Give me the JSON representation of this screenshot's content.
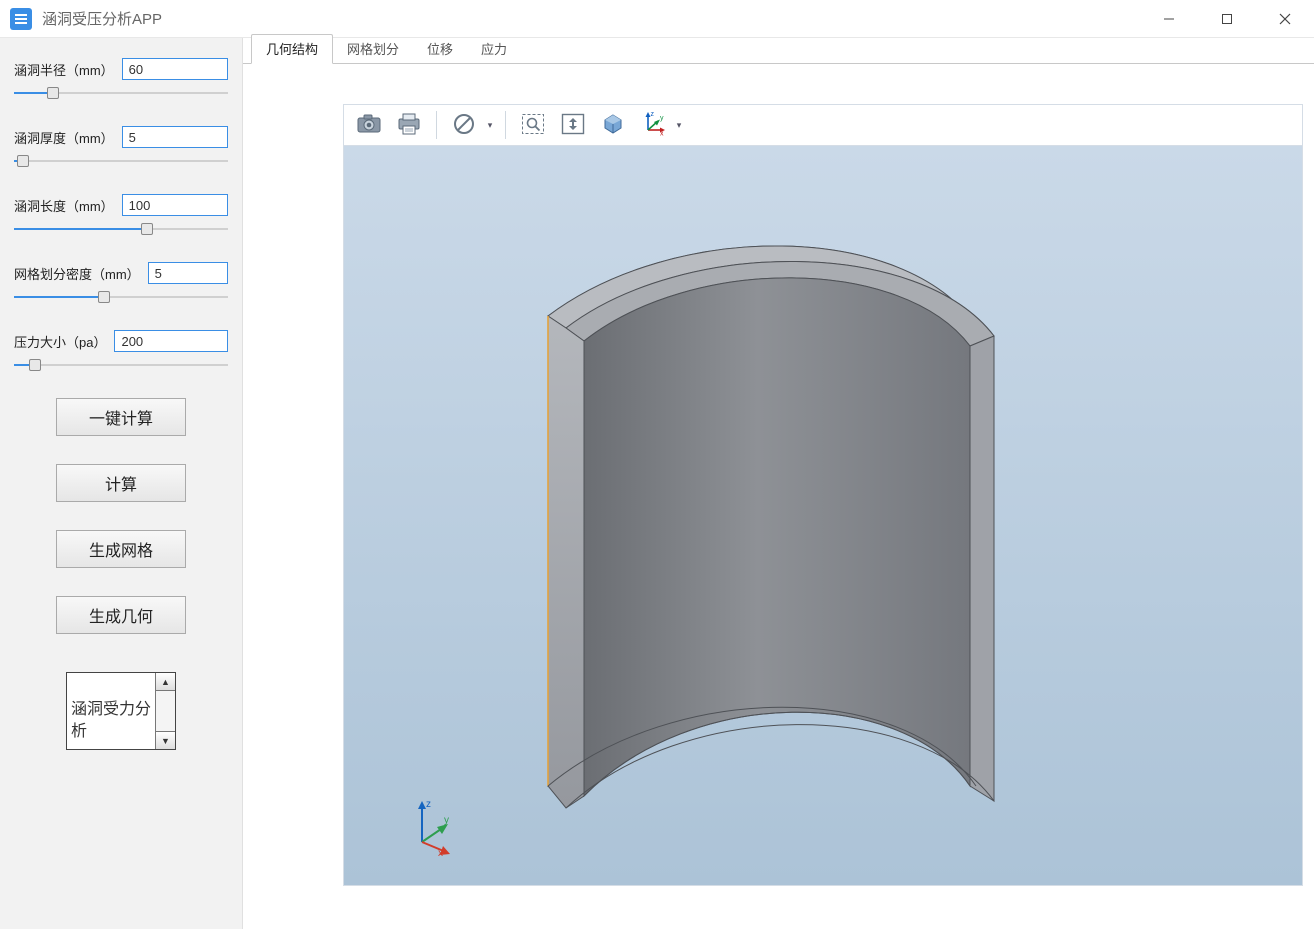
{
  "window": {
    "title": "涵洞受压分析APP"
  },
  "sidebar": {
    "fields": [
      {
        "label": "涵洞半径（mm）",
        "value": "60",
        "slider_pct": 18
      },
      {
        "label": "涵洞厚度（mm）",
        "value": "5",
        "slider_pct": 4
      },
      {
        "label": "涵洞长度（mm）",
        "value": "100",
        "slider_pct": 62
      },
      {
        "label": "网格划分密度（mm）",
        "value": "5",
        "slider_pct": 42
      },
      {
        "label": "压力大小（pa）",
        "value": "200",
        "slider_pct": 10
      }
    ],
    "buttons": {
      "one_click": "一键计算",
      "calculate": "计算",
      "gen_mesh": "生成网格",
      "gen_geom": "生成几何"
    },
    "listbox_text": "涵洞受力分析"
  },
  "tabs": [
    {
      "label": "几何结构",
      "active": true
    },
    {
      "label": "网格划分",
      "active": false
    },
    {
      "label": "位移",
      "active": false
    },
    {
      "label": "应力",
      "active": false
    }
  ],
  "toolbar_icons": {
    "camera": "camera-icon",
    "print": "print-icon",
    "forbid": "no-symbol-icon",
    "zoom_box": "zoom-box-icon",
    "fit": "fit-view-icon",
    "rotate": "rotate-view-icon",
    "axes": "axes-icon"
  },
  "axes": {
    "x": "x",
    "y": "y",
    "z": "z"
  }
}
